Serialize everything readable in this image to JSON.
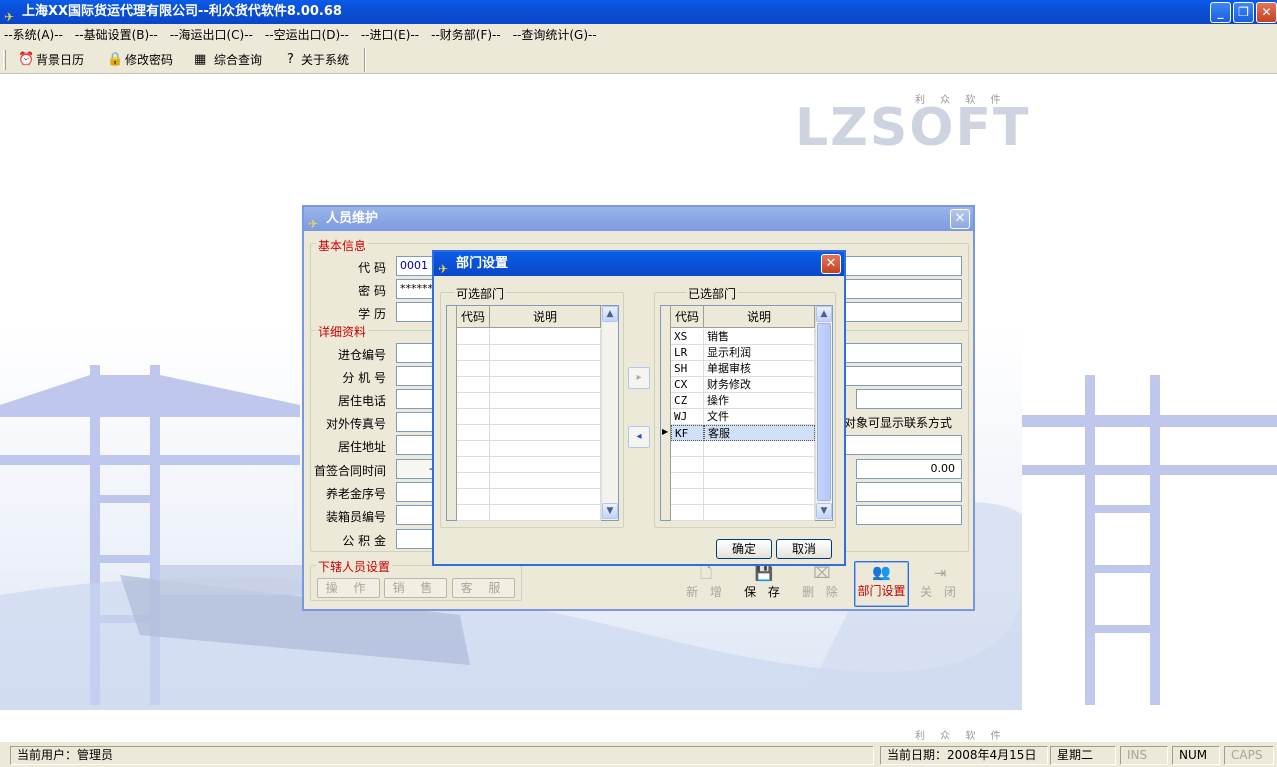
{
  "app": {
    "title": "上海XX国际货运代理有限公司--利众货代软件8.00.68"
  },
  "menu": [
    "--系统(A)--",
    "--基础设置(B)--",
    "--海运出口(C)--",
    "--空运出口(D)--",
    "--进口(E)--",
    "--财务部(F)--",
    "--查询统计(G)--"
  ],
  "toolbar": {
    "calendar": "背景日历",
    "password": "修改密码",
    "query": "综合查询",
    "about": "关于系统"
  },
  "logo": {
    "text": "LZSOFT",
    "sub": "利 众 软 件"
  },
  "personnel": {
    "title": "人员维护",
    "basic_group": "基本信息",
    "detail_group": "详细资料",
    "sub_group": "下辖人员设置",
    "labels": {
      "code": "代 码",
      "password": "密 码",
      "education": "学 历",
      "warehouse_no": "进仓编号",
      "ext": "分 机 号",
      "home_phone": "居住电话",
      "fax": "对外传真号",
      "address": "居住地址",
      "contract_time": "首签合同时间",
      "pension_no": "养老金序号",
      "packer_no": "装箱员编号",
      "fund": "公 积 金"
    },
    "values": {
      "code": "0001",
      "password": "******",
      "contract_time": "-",
      "amount": "0.00"
    },
    "note": "对象可显示联系方式",
    "sub_buttons": [
      "操 作",
      "销 售",
      "客 服"
    ],
    "buttons": {
      "new": "新 增",
      "save": "保 存",
      "delete": "删 除",
      "dept": "部门设置",
      "close": "关 闭"
    }
  },
  "dept": {
    "title": "部门设置",
    "available_label": "可选部门",
    "selected_label": "已选部门",
    "col_code": "代码",
    "col_desc": "说明",
    "rows": [
      {
        "code": "XS",
        "desc": "销售"
      },
      {
        "code": "LR",
        "desc": "显示利润"
      },
      {
        "code": "SH",
        "desc": "单据审核"
      },
      {
        "code": "CX",
        "desc": "财务修改"
      },
      {
        "code": "CZ",
        "desc": "操作"
      },
      {
        "code": "WJ",
        "desc": "文件"
      },
      {
        "code": "KF",
        "desc": "客服"
      }
    ],
    "ok": "确定",
    "cancel": "取消"
  },
  "status": {
    "user": "当前用户：管理员",
    "date": "当前日期：2008年4月15日",
    "weekday": "星期二",
    "ins": "INS",
    "num": "NUM",
    "caps": "CAPS"
  }
}
